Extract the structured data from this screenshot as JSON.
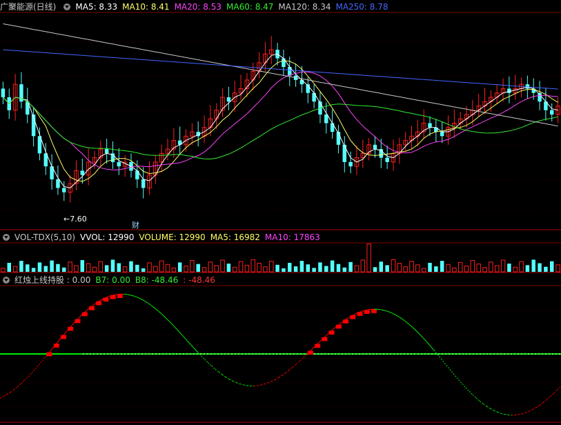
{
  "header": {
    "title": "广聚能源(日线)",
    "ma": [
      {
        "label": "MA5: 8.33",
        "color": "#ffffff"
      },
      {
        "label": "MA10: 8.41",
        "color": "#ffff66"
      },
      {
        "label": "MA20: 8.53",
        "color": "#ff44ff"
      },
      {
        "label": "MA60: 8.47",
        "color": "#33ee33"
      },
      {
        "label": "MA120: 8.34",
        "color": "#c8c8c8"
      },
      {
        "label": "MA250: 8.78",
        "color": "#4466ff"
      }
    ]
  },
  "volume_header": {
    "title": "VOL-TDX(5,10)",
    "items": [
      {
        "label": "VVOL: 12990",
        "color": "#ffffff"
      },
      {
        "label": "VOLUME: 12990",
        "color": "#ffff66"
      },
      {
        "label": "MA5: 16982",
        "color": "#ffff66"
      },
      {
        "label": "MA10: 17863",
        "color": "#ff44ff"
      }
    ]
  },
  "indicator_header": {
    "title": "红烛上线持股 : 0.00",
    "items": [
      {
        "label": "B7: 0.00",
        "color": "#33ee33"
      },
      {
        "label": "B8: -48.46",
        "color": "#33ee33"
      },
      {
        "label": ": -48.46",
        "color": "#ff3333"
      }
    ]
  },
  "annotations": {
    "low_label": "←7.60",
    "finance_mark": "财"
  },
  "colors": {
    "up": "#ff2020",
    "down": "#54ffff",
    "ind_up": "#ff0000",
    "ind_down": "#00ee00"
  },
  "chart_data": {
    "type": "candlestick",
    "price_range": [
      7.4,
      9.7
    ],
    "candle_close": [
      8.75,
      8.6,
      8.9,
      8.7,
      8.55,
      8.3,
      8.1,
      7.95,
      7.8,
      7.7,
      7.65,
      7.75,
      7.9,
      7.85,
      8.0,
      8.05,
      8.15,
      8.1,
      8.0,
      7.95,
      8.0,
      7.9,
      7.8,
      7.7,
      7.85,
      8.0,
      8.1,
      8.15,
      8.25,
      8.2,
      8.3,
      8.35,
      8.3,
      8.4,
      8.5,
      8.6,
      8.75,
      8.7,
      8.8,
      8.85,
      8.95,
      9.05,
      9.15,
      9.25,
      9.3,
      9.2,
      9.1,
      9.0,
      8.95,
      8.9,
      8.8,
      8.7,
      8.55,
      8.45,
      8.35,
      8.2,
      8.0,
      7.95,
      8.05,
      8.1,
      8.2,
      8.15,
      8.05,
      8.0,
      8.1,
      8.2,
      8.25,
      8.3,
      8.35,
      8.45,
      8.4,
      8.35,
      8.3,
      8.4,
      8.45,
      8.5,
      8.55,
      8.6,
      8.65,
      8.7,
      8.75,
      8.8,
      8.85,
      8.8,
      8.85,
      8.9,
      8.85,
      8.8,
      8.7,
      8.6,
      8.55,
      8.65
    ],
    "ma_series": [
      "MA5",
      "MA10",
      "MA20",
      "MA60",
      "MA120",
      "MA250"
    ],
    "volume": {
      "range": [
        0,
        60000
      ]
    },
    "indicator": {
      "range": [
        -100,
        100
      ],
      "zero_line": 0
    }
  }
}
